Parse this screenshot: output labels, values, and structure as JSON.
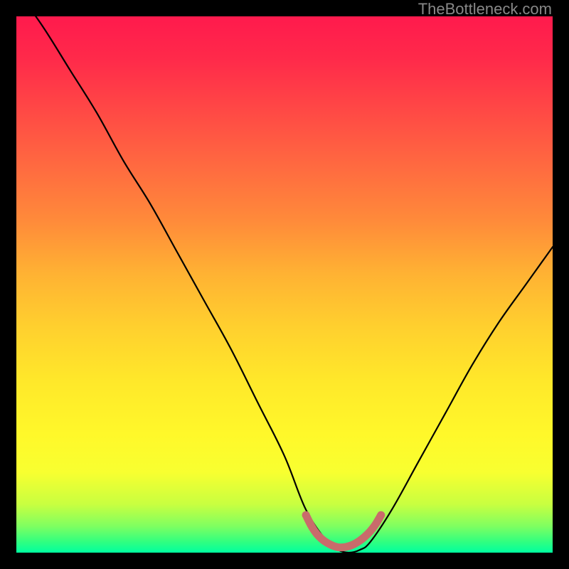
{
  "watermark": "TheBottleneck.com",
  "chart_data": {
    "type": "line",
    "title": "",
    "xlabel": "",
    "ylabel": "",
    "xlim": [
      0,
      100
    ],
    "ylim": [
      0,
      100
    ],
    "series": [
      {
        "name": "bottleneck-curve",
        "x": [
          0,
          5,
          10,
          15,
          20,
          25,
          30,
          35,
          40,
          45,
          50,
          54,
          58,
          60,
          62,
          64,
          66,
          70,
          75,
          80,
          85,
          90,
          95,
          100
        ],
        "values": [
          105,
          98,
          90,
          82,
          73,
          65,
          56,
          47,
          38,
          28,
          18,
          8,
          2,
          0.5,
          0,
          0.5,
          2,
          8,
          17,
          26,
          35,
          43,
          50,
          57
        ]
      },
      {
        "name": "valley-marker",
        "x": [
          54,
          55,
          56,
          57,
          58,
          59,
          60,
          61,
          62,
          63,
          64,
          65,
          66,
          67,
          68
        ],
        "values": [
          7,
          5,
          3.5,
          2.5,
          1.8,
          1.3,
          1,
          1,
          1.2,
          1.6,
          2.2,
          3,
          4,
          5.3,
          7
        ]
      }
    ]
  }
}
